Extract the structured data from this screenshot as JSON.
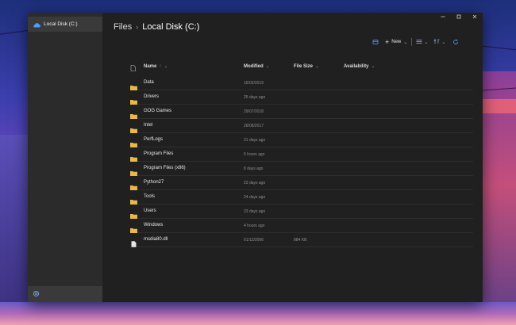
{
  "window": {
    "title": "Files",
    "location": "Local Disk (C:)"
  },
  "sidebar": {
    "items": [
      {
        "label": "Local Disk (C:)",
        "icon": "cloud-drive-icon"
      }
    ],
    "footer_icon": "settings-gear-icon"
  },
  "toolbar": {
    "new_label": "New"
  },
  "columns": {
    "name": "Name",
    "modified": "Modified",
    "size": "File Size",
    "availability": "Availability"
  },
  "files": [
    {
      "name": "Data",
      "modified": "15/02/2019",
      "size": "",
      "type": "folder"
    },
    {
      "name": "Drivers",
      "modified": "25 days ago",
      "size": "",
      "type": "folder"
    },
    {
      "name": "GOG Games",
      "modified": "29/07/2018",
      "size": "",
      "type": "folder"
    },
    {
      "name": "Intel",
      "modified": "26/06/2017",
      "size": "",
      "type": "folder"
    },
    {
      "name": "PerfLogs",
      "modified": "31 days ago",
      "size": "",
      "type": "folder"
    },
    {
      "name": "Program Files",
      "modified": "5 hours ago",
      "size": "",
      "type": "folder"
    },
    {
      "name": "Program Files (x86)",
      "modified": "8 days ago",
      "size": "",
      "type": "folder"
    },
    {
      "name": "Python27",
      "modified": "23 days ago",
      "size": "",
      "type": "folder"
    },
    {
      "name": "Tools",
      "modified": "24 days ago",
      "size": "",
      "type": "folder"
    },
    {
      "name": "Users",
      "modified": "23 days ago",
      "size": "",
      "type": "folder"
    },
    {
      "name": "Windows",
      "modified": "4 hours ago",
      "size": "",
      "type": "folder"
    },
    {
      "name": "msdia80.dll",
      "modified": "01/12/2006",
      "size": "884 KB",
      "type": "file"
    }
  ],
  "colors": {
    "folder": "#e8b84a",
    "accent": "#4a9eff",
    "window_bg": "#202020",
    "sidebar_bg": "#2b2b2b"
  }
}
